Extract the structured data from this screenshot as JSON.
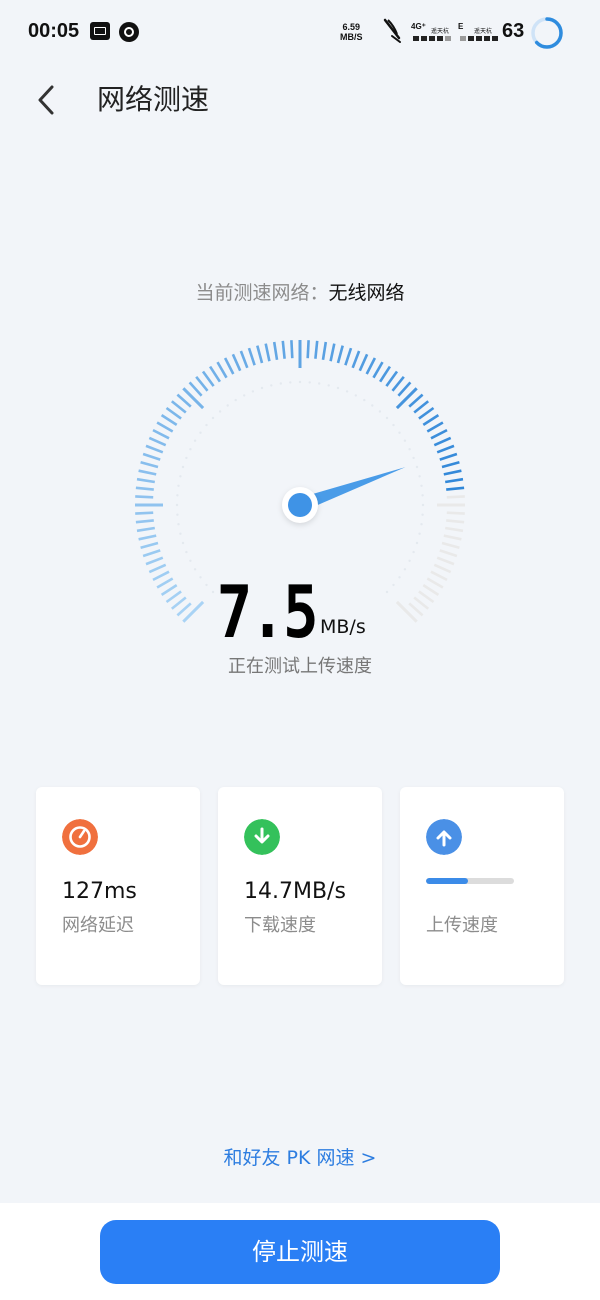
{
  "status_bar": {
    "time": "00:05",
    "net_speed_value": "6.59",
    "net_speed_unit": "MB/S",
    "sim1_tag": "4G⁺",
    "sim1_carrier": "遥天杭",
    "sim2_tag": "E",
    "sim2_carrier": "遥天杭",
    "battery_level": "63"
  },
  "header": {
    "title": "网络测速",
    "back_icon": "chevron-left-icon"
  },
  "network": {
    "label": "当前测速网络：",
    "value": "无线网络"
  },
  "gauge": {
    "needle_fraction": 0.76,
    "active_fraction": 0.82,
    "color_light": "#a9d3f5",
    "color_dark": "#2f86d8",
    "color_inactive": "#e9e9e9"
  },
  "speed": {
    "value": "7.5",
    "unit": "MB/s",
    "status": "正在测试上传速度"
  },
  "cards": {
    "latency": {
      "value": "127ms",
      "label": "网络延迟",
      "icon": "gauge-icon",
      "color": "#f0703e"
    },
    "download": {
      "value": "14.7MB/s",
      "label": "下载速度",
      "icon": "arrow-down-icon",
      "color": "#34c15b"
    },
    "upload": {
      "label": "上传速度",
      "icon": "arrow-up-icon",
      "color": "#4a90e6",
      "progress_fraction": 0.48
    }
  },
  "pk_link": "和好友 PK 网速 >",
  "stop_button": "停止测速"
}
